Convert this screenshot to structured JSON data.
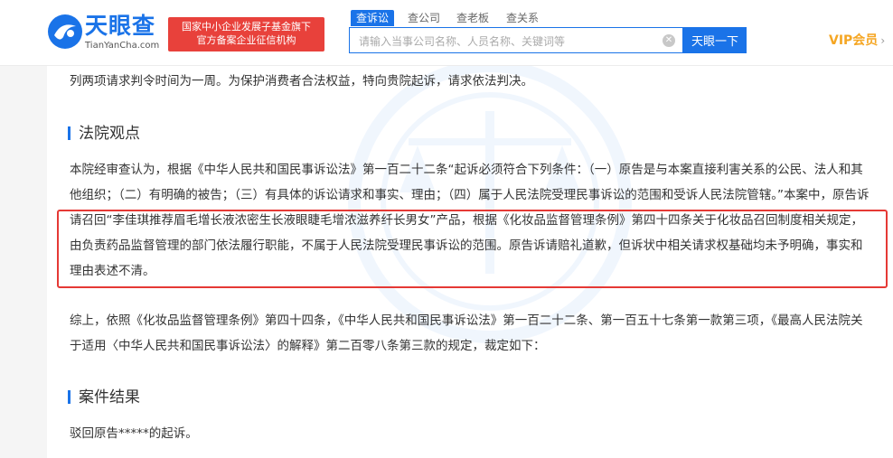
{
  "header": {
    "logo_text": "天眼查",
    "logo_sub": "TianYanCha.com",
    "badge_line1": "国家中小企业发展子基金旗下",
    "badge_line2": "官方备案企业征信机构",
    "tabs": [
      {
        "label": "查诉讼",
        "active": true
      },
      {
        "label": "查公司",
        "active": false
      },
      {
        "label": "查老板",
        "active": false
      },
      {
        "label": "查关系",
        "active": false
      }
    ],
    "search_placeholder": "请输入当事公司名称、人员名称、关键词等",
    "search_button": "天眼一下",
    "vip_label": "VIP会员",
    "accent_color": "#1a73e8"
  },
  "content": {
    "intro_text": "列两项请求判令时间为一周。为保护消费者合法权益，特向贵院起诉，请求依法判决。",
    "section_court_title": "法院观点",
    "court_para_text": "本院经审查认为，根据《中华人民共和国民事诉讼法》第一百二十二条“起诉必须符合下列条件：（一）原告是与本案直接利害关系的公民、法人和其他组织；（二）有明确的被告；（三）有具体的诉讼请求和事实、理由；（四）属于人民法院受理民事诉讼的范围和受诉人民法院管辖。”本案中，原告诉请召回“李佳琪推荐眉毛增长液浓密生长液眼睫毛增浓滋养纤长男女”产品，根据《化妆品监督管理条例》第四十四条关于化妆品召回制度相关规定，由负责药品监督管理的部门依法履行职能，不属于人民法院受理民事诉讼的范围。原告诉请赔礼道歉，但诉状中相关请求权基础均未予明确，事实和理由表述不清。",
    "summary_text": "综上，依照《化妆品监督管理条例》第四十四条，《中华人民共和国民事诉讼法》第一百二十二条、第一百五十七条第一款第三项，《最高人民法院关于适用〈中华人民共和国民事诉讼法〉的解释》第二百零八条第三款的规定，裁定如下：",
    "section_result_title": "案件结果",
    "result_text": "驳回原告*****的起诉。",
    "highlight_color": "#e53935"
  }
}
